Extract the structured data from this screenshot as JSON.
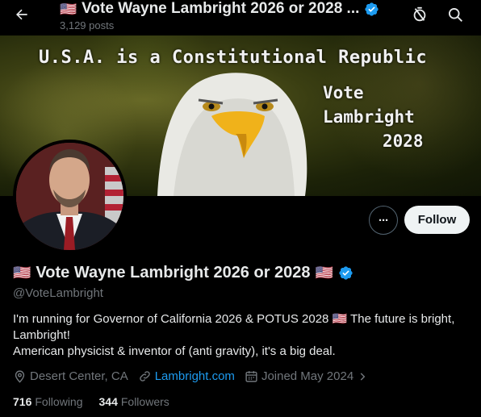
{
  "header": {
    "flag_left": "🇺🇸",
    "title": "Vote Wayne Lambright 2026 or 2028 ...",
    "post_count": "3,129 posts"
  },
  "banner": {
    "headline": "U.S.A. is a Constitutional Republic",
    "vote_line1": "Vote",
    "vote_line2": "Lambright",
    "vote_line3": "2028"
  },
  "actions": {
    "more_label": "···",
    "follow_label": "Follow"
  },
  "profile": {
    "flag_left": "🇺🇸",
    "name": "Vote Wayne Lambright 2026 or 2028",
    "flag_right": "🇺🇸",
    "handle": "@VoteLambright",
    "bio_line1": "I'm running for Governor of California 2026 & POTUS 2028 🇺🇸 The future is bright, Lambright!",
    "bio_line2": "American physicist & inventor of (anti gravity), it's a big deal.",
    "location": "Desert Center, CA",
    "website": "Lambright.com",
    "joined": "Joined May 2024",
    "following_count": "716",
    "following_label": "Following",
    "followers_count": "344",
    "followers_label": "Followers"
  },
  "colors": {
    "accent": "#1d9bf0",
    "muted": "#71767b",
    "text": "#e7e9ea",
    "background": "#000000"
  },
  "icons": [
    "back-arrow-icon",
    "verified-badge-icon",
    "no-notifications-icon",
    "search-icon",
    "location-pin-icon",
    "link-icon",
    "calendar-icon",
    "chevron-right-icon"
  ]
}
